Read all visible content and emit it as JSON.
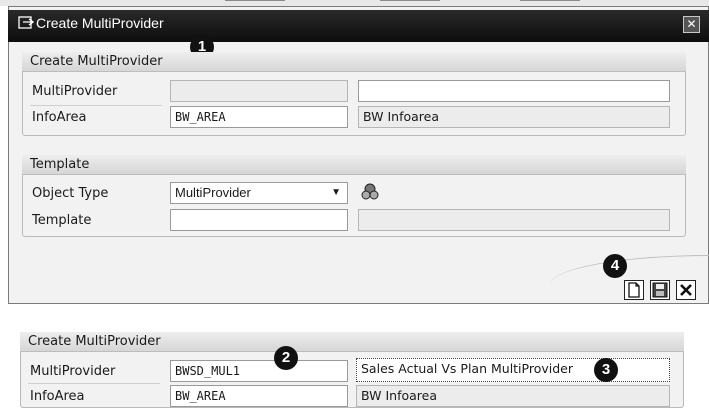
{
  "dialog": {
    "title": "Create MultiProvider",
    "close_symbol": "✕",
    "create_group": {
      "header": "Create MultiProvider",
      "multiprovider_label": "MultiProvider",
      "multiprovider_value": "",
      "multiprovider_desc": "",
      "infoarea_label": "InfoArea",
      "infoarea_value": "BW_AREA",
      "infoarea_desc": "BW Infoarea"
    },
    "template_group": {
      "header": "Template",
      "object_type_label": "Object Type",
      "object_type_value": "MultiProvider",
      "template_label": "Template",
      "template_value": "",
      "template_desc": ""
    },
    "icons": {
      "title_icon": "dialog-icon",
      "object_type_icon": "hierarchy-icon",
      "new_icon": "new-document-icon",
      "save_icon": "save-icon",
      "cancel_icon": "cancel-icon"
    }
  },
  "bottom_panel": {
    "header": "Create MultiProvider",
    "multiprovider_label": "MultiProvider",
    "multiprovider_value": "BWSD_MUL1",
    "multiprovider_desc": "Sales Actual Vs Plan MultiProvider",
    "infoarea_label": "InfoArea",
    "infoarea_value": "BW_AREA",
    "infoarea_desc": "BW Infoarea"
  },
  "markers": [
    "1",
    "2",
    "3",
    "4"
  ]
}
